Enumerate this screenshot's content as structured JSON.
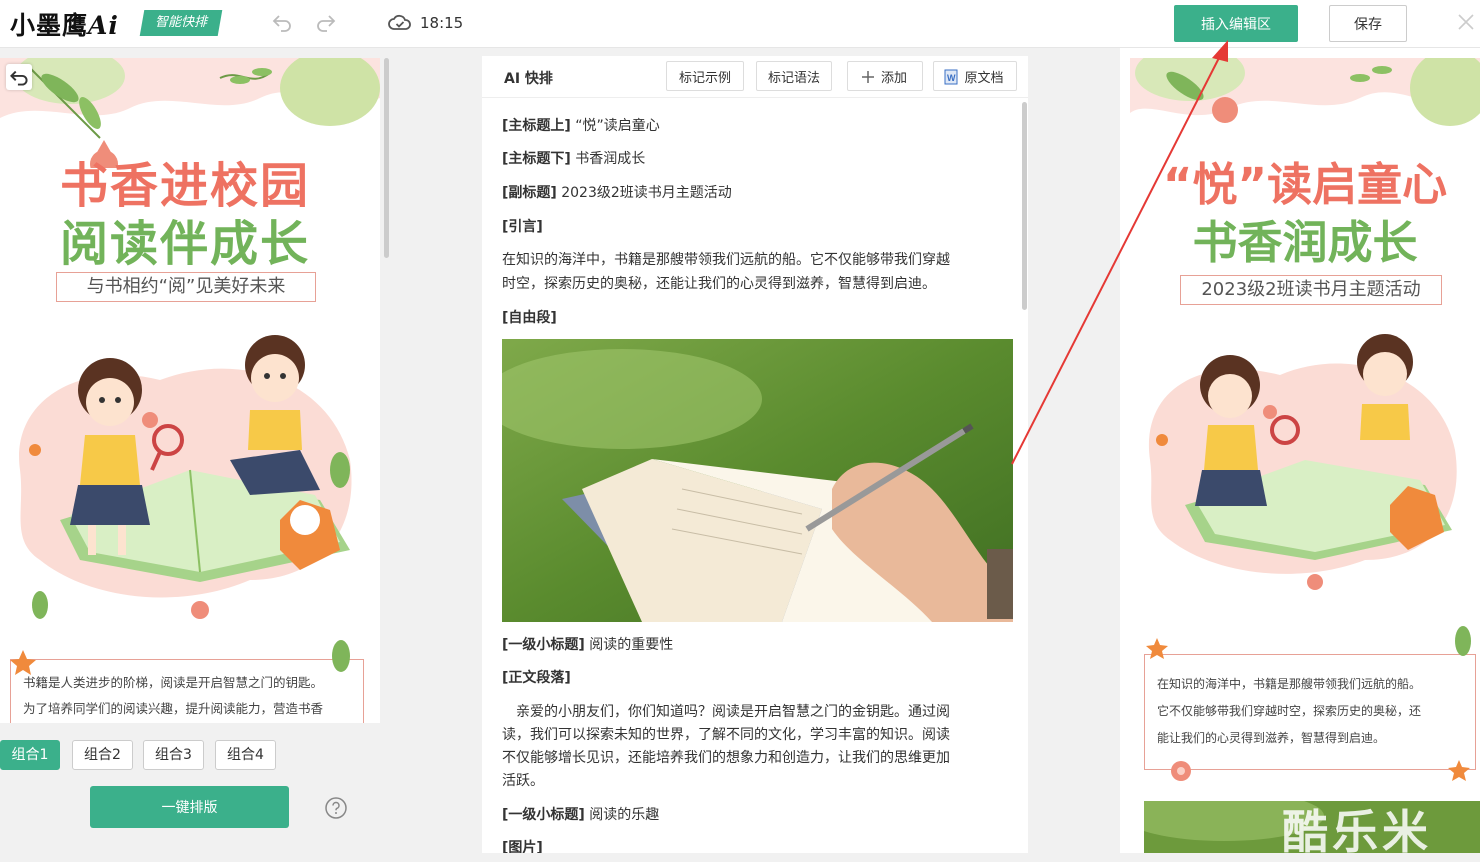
{
  "header": {
    "logo_text": "小墨鹰",
    "logo_ai": "Ai",
    "badge": "智能快排",
    "save_time": "18:15",
    "insert_button": "插入编辑区",
    "save_button": "保存"
  },
  "left_panel": {
    "poster_title_line1": "书香进校园",
    "poster_title_line2": "阅读伴成长",
    "poster_subtitle": "与书相约“阅”见美好未来",
    "paragraph_line1": "书籍是人类进步的阶梯，阅读是开启智慧之门的钥匙。",
    "paragraph_line2": "为了培养同学们的阅读兴趣，提升阅读能力，营造书香",
    "tabs": [
      "组合1",
      "组合2",
      "组合3",
      "组合4"
    ],
    "active_tab": 0,
    "one_key_button": "一键排版"
  },
  "middle_panel": {
    "title": "AI 快排",
    "toolbar": {
      "mark_example": "标记示例",
      "mark_syntax": "标记语法",
      "add": "添加",
      "original": "原文档"
    },
    "lines": {
      "l1_tag": "[主标题上]",
      "l1_text": " “悦”读启童心",
      "l2_tag": "[主标题下]",
      "l2_text": " 书香润成长",
      "l3_tag": "[副标题]",
      "l3_text": " 2023级2班读书月主题活动",
      "l4_tag": "[引言]",
      "l5_text": "在知识的海洋中，书籍是那艘带领我们远航的船。它不仅能够带我们穿越",
      "l6_text": "时空，探索历史的奥秘，还能让我们的心灵得到滋养，智慧得到启迪。",
      "l7_tag": "[自由段]",
      "l8_tag": "[一级小标题]",
      "l8_text": " 阅读的重要性",
      "l9_tag": "[正文段落]",
      "l10_text": "　亲爱的小朋友们，你们知道吗？阅读是开启智慧之门的金钥匙。通过阅",
      "l11_text": "读，我们可以探索未知的世界，了解不同的文化，学习丰富的知识。阅读",
      "l12_text": "不仅能够增长见识，还能培养我们的想象力和创造力，让我们的思维更加",
      "l13_text": "活跃。",
      "l14_tag": "[一级小标题]",
      "l14_text": " 阅读的乐趣",
      "l15_tag": "[图片]"
    }
  },
  "right_panel": {
    "title_line1": "“悦”读启童心",
    "title_line2": "书香润成长",
    "subtitle": "2023级2班读书月主题活动",
    "paragraph_line1": "在知识的海洋中，书籍是那艘带领我们远航的船。",
    "paragraph_line2": "它不仅能够带我们穿越时空，探索历史的奥秘，还",
    "paragraph_line3": "能让我们的心灵得到滋养，智慧得到启迪。"
  },
  "watermark": "酷乐米",
  "colors": {
    "accent": "#3bb08b",
    "title_red": "#ee7262",
    "title_green": "#72b35a",
    "border_pink": "#e7a196",
    "arrow": "#e53935"
  }
}
